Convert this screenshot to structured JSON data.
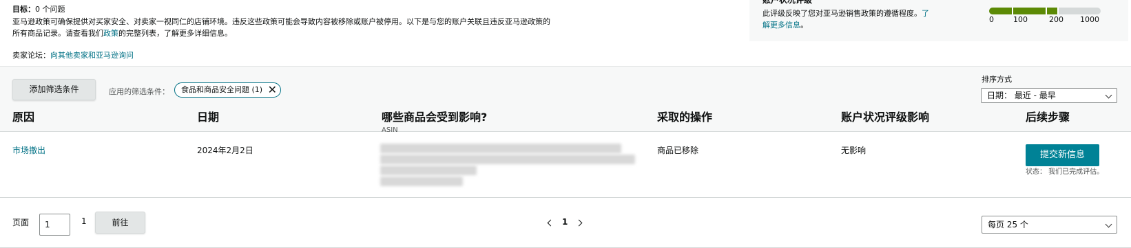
{
  "goal": {
    "label": "目标：",
    "value": "0 个问题"
  },
  "description": {
    "text_before_link": "亚马逊政策可确保提供对买家安全、对卖家一视同仁的店铺环境。违反这些政策可能会导致内容被移除或账户被停用。以下是与您的账户关联且违反亚马逊政策的所有商品记录。请查看我们",
    "link": "政策",
    "text_after_link": "的完整列表，了解更多详细信息。"
  },
  "forum": {
    "label": "卖家论坛：",
    "link": "向其他卖家和亚马逊询问"
  },
  "rating": {
    "heading": "账户状况评级",
    "text": "此评级反映了您对亚马逊销售政策的遵循程度。",
    "link": "了解更多信息",
    "link_suffix": "。",
    "meter_labels": [
      "0",
      "100",
      "200",
      "1000"
    ],
    "meter_fill_fraction": 0.62,
    "meter_color": "#5c8a05"
  },
  "filters": {
    "add_button": "添加筛选条件",
    "applied_label": "应用的筛选条件：",
    "chip_label": "食品和商品安全问题 (1)",
    "chip_close_icon": "close-icon"
  },
  "sort": {
    "label": "排序方式",
    "selected": "日期： 最近 - 最早"
  },
  "table": {
    "headers": [
      "原因",
      "日期",
      "哪些商品会受到影响?",
      "采取的操作",
      "账户状况评级影响",
      "后续步骤"
    ],
    "product_subheader": "ASIN",
    "rows": [
      {
        "reason": "市场撤出",
        "date": "2024年2月2日",
        "action": "商品已移除",
        "impact": "无影响",
        "next_step_button": "提交新信息",
        "status": "状态： 我们已完成评估。"
      }
    ]
  },
  "pagination": {
    "page_label": "页面",
    "page_input": "1",
    "total_pages": "1",
    "go_button": "前往",
    "current_page": "1",
    "per_page": "每页 25 个"
  },
  "colors": {
    "link": "#007185",
    "primary_button": "#008296",
    "band_bg": "#f7f8f8"
  }
}
